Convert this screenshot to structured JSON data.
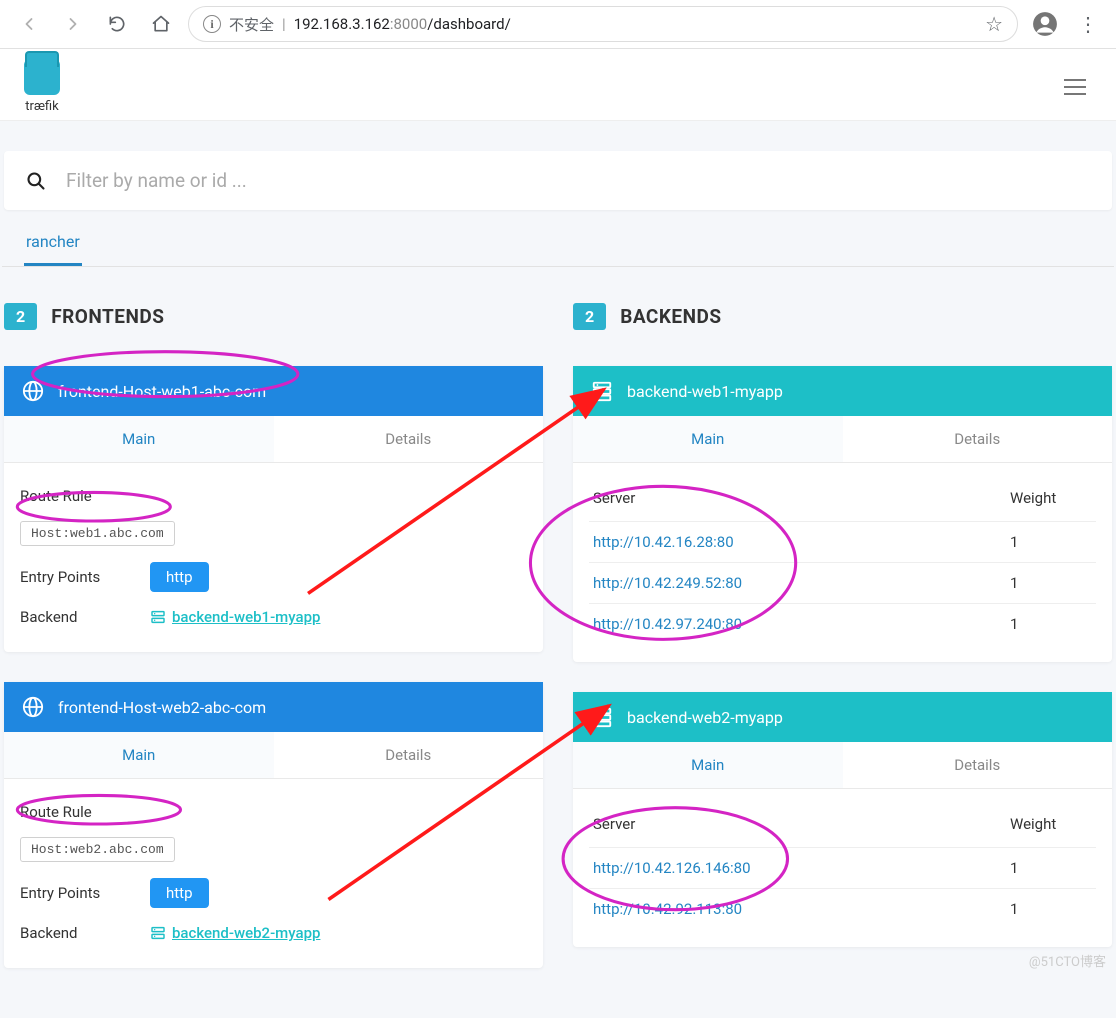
{
  "browser": {
    "insecure_label": "不安全",
    "url_host": "192.168.3.162",
    "url_port": ":8000",
    "url_path": "/dashboard/"
  },
  "logo_label": "træfik",
  "search": {
    "placeholder": "Filter by name or id ..."
  },
  "provider_tab": "rancher",
  "frontends": {
    "title": "FRONTENDS",
    "count": "2",
    "tab_main": "Main",
    "tab_details": "Details",
    "label_route_rule": "Route Rule",
    "label_entry_points": "Entry Points",
    "label_backend": "Backend",
    "items": [
      {
        "name": "frontend-Host-web1-abc-com",
        "rule": "Host:web1.abc.com",
        "entry_point": "http",
        "backend": "backend-web1-myapp"
      },
      {
        "name": "frontend-Host-web2-abc-com",
        "rule": "Host:web2.abc.com",
        "entry_point": "http",
        "backend": "backend-web2-myapp"
      }
    ]
  },
  "backends": {
    "title": "BACKENDS",
    "count": "2",
    "th_server": "Server",
    "th_weight": "Weight",
    "items": [
      {
        "name": "backend-web1-myapp",
        "servers": [
          {
            "url": "http://10.42.16.28:80",
            "weight": "1"
          },
          {
            "url": "http://10.42.249.52:80",
            "weight": "1"
          },
          {
            "url": "http://10.42.97.240:80",
            "weight": "1"
          }
        ]
      },
      {
        "name": "backend-web2-myapp",
        "servers": [
          {
            "url": "http://10.42.126.146:80",
            "weight": "1"
          },
          {
            "url": "http://10.42.92.113:80",
            "weight": "1"
          }
        ]
      }
    ]
  },
  "watermark": "@51CTO博客"
}
